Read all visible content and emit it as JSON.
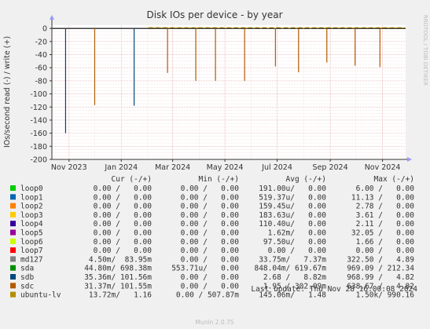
{
  "chart_data": {
    "type": "line",
    "title": "Disk IOs per device - by year",
    "ylabel": "IOs/second read (-) / write (+)",
    "side_label": "RRDTOOL / TOBI OETIKER",
    "ylim": [
      -200,
      5
    ],
    "yticks": [
      0,
      -20,
      -40,
      -60,
      -80,
      -100,
      -120,
      -140,
      -160,
      -180,
      -200
    ],
    "xticks": [
      {
        "label": "Nov 2023",
        "date": "2023-11-01"
      },
      {
        "label": "Jan 2024",
        "date": "2024-01-01"
      },
      {
        "label": "Mar 2024",
        "date": "2024-03-01"
      },
      {
        "label": "May 2024",
        "date": "2024-05-01"
      },
      {
        "label": "Jul 2024",
        "date": "2024-07-01"
      },
      {
        "label": "Sep 2024",
        "date": "2024-09-01"
      },
      {
        "label": "Nov 2024",
        "date": "2024-11-01"
      }
    ],
    "xrange": [
      "2023-10-12",
      "2024-11-28"
    ],
    "grid": true,
    "series": [
      {
        "name": "loop0",
        "color": "#00cc00",
        "spikes": []
      },
      {
        "name": "loop1",
        "color": "#0066b3",
        "spikes": []
      },
      {
        "name": "loop2",
        "color": "#ff8000",
        "spikes": []
      },
      {
        "name": "loop3",
        "color": "#ffcc00",
        "spikes": []
      },
      {
        "name": "loop4",
        "color": "#330099",
        "spikes": []
      },
      {
        "name": "loop5",
        "color": "#990099",
        "spikes": []
      },
      {
        "name": "loop6",
        "color": "#ccff00",
        "spikes": []
      },
      {
        "name": "loop7",
        "color": "#ff0000",
        "spikes": []
      },
      {
        "name": "md127",
        "color": "#808080",
        "spikes": []
      },
      {
        "name": "sda",
        "color": "#008f00",
        "spikes": []
      },
      {
        "name": "sdb",
        "color": "#00487d",
        "spikes": [
          {
            "date": "2023-10-28",
            "value": -160
          },
          {
            "date": "2024-01-16",
            "value": -118
          }
        ]
      },
      {
        "name": "sdc",
        "color": "#b35a00",
        "spikes": [
          {
            "date": "2023-12-01",
            "value": -117
          },
          {
            "date": "2024-02-24",
            "value": -68
          },
          {
            "date": "2024-03-28",
            "value": -80
          },
          {
            "date": "2024-04-20",
            "value": -80
          },
          {
            "date": "2024-05-24",
            "value": -80
          },
          {
            "date": "2024-06-29",
            "value": -58
          },
          {
            "date": "2024-07-26",
            "value": -67
          },
          {
            "date": "2024-08-28",
            "value": -52
          },
          {
            "date": "2024-09-30",
            "value": -57
          },
          {
            "date": "2024-10-29",
            "value": -59
          }
        ]
      },
      {
        "name": "ubuntu-lv",
        "color": "#b38f00",
        "spikes": []
      }
    ],
    "legend": {
      "headers": [
        "Cur (-/+)",
        "Min (-/+)",
        "Avg (-/+)",
        "Max (-/+)"
      ],
      "rows": [
        {
          "name": "loop0",
          "cur": "0.00 /   0.00",
          "min": "0.00 /   0.00",
          "avg": "191.00u/   0.00",
          "max": "6.00 /   0.00"
        },
        {
          "name": "loop1",
          "cur": "0.00 /   0.00",
          "min": "0.00 /   0.00",
          "avg": "519.37u/   0.00",
          "max": "11.13 /   0.00"
        },
        {
          "name": "loop2",
          "cur": "0.00 /   0.00",
          "min": "0.00 /   0.00",
          "avg": "159.45u/   0.00",
          "max": "2.78 /   0.00"
        },
        {
          "name": "loop3",
          "cur": "0.00 /   0.00",
          "min": "0.00 /   0.00",
          "avg": "183.63u/   0.00",
          "max": "3.61 /   0.00"
        },
        {
          "name": "loop4",
          "cur": "0.00 /   0.00",
          "min": "0.00 /   0.00",
          "avg": "110.40u/   0.00",
          "max": "2.11 /   0.00"
        },
        {
          "name": "loop5",
          "cur": "0.00 /   0.00",
          "min": "0.00 /   0.00",
          "avg": "1.62m/   0.00",
          "max": "32.05 /   0.00"
        },
        {
          "name": "loop6",
          "cur": "0.00 /   0.00",
          "min": "0.00 /   0.00",
          "avg": "97.50u/   0.00",
          "max": "1.66 /   0.00"
        },
        {
          "name": "loop7",
          "cur": "0.00 /   0.00",
          "min": "0.00 /   0.00",
          "avg": "0.00 /   0.00",
          "max": "0.00 /   0.00"
        },
        {
          "name": "md127",
          "cur": "4.50m/  83.95m",
          "min": "0.00 /   0.00",
          "avg": "33.75m/   7.37m",
          "max": "322.50 /   4.89"
        },
        {
          "name": "sda",
          "cur": "44.80m/ 698.38m",
          "min": "553.71u/   0.00",
          "avg": "848.04m/ 619.67m",
          "max": "969.09 / 212.34"
        },
        {
          "name": "sdb",
          "cur": "35.36m/ 101.56m",
          "min": "0.00 /   0.00",
          "avg": "2.68 /   8.82m",
          "max": "968.99 /   4.82"
        },
        {
          "name": "sdc",
          "cur": "31.37m/ 101.55m",
          "min": "0.00 /   0.00",
          "avg": "1.95 / 302.09m",
          "max": "638.67 /   4.82"
        },
        {
          "name": "ubuntu-lv",
          "cur": "13.72m/   1.16",
          "min": "0.00 / 507.87m",
          "avg": "145.06m/   1.48",
          "max": "1.50k/ 990.16"
        }
      ]
    },
    "last_update": "Last update: Thu Nov 28 16:00:08 2024",
    "footer": "Munin 2.0.75"
  }
}
